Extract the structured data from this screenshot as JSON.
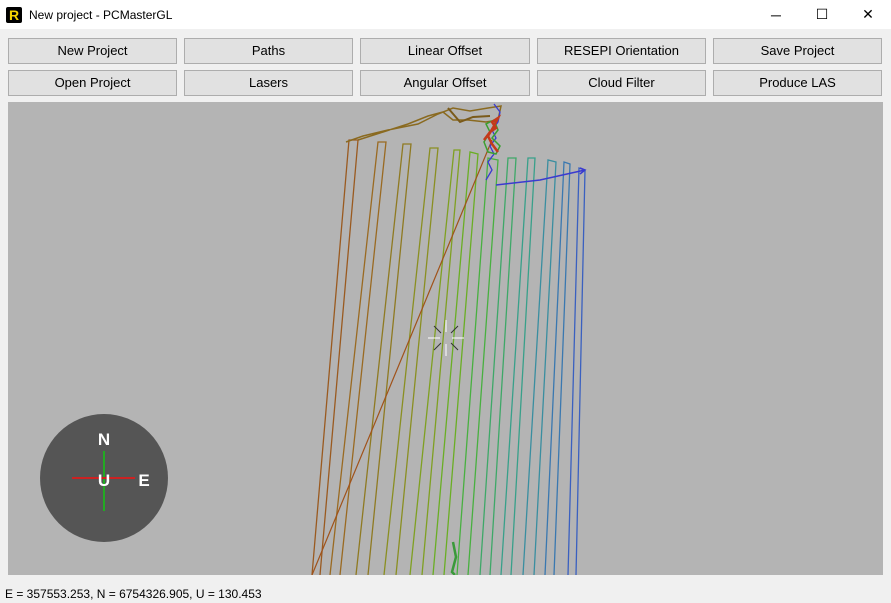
{
  "window": {
    "title": "New project - PCMasterGL",
    "app_icon_letter": "R",
    "minimize_glyph": "─",
    "maximize_glyph": "☐",
    "close_glyph": "✕"
  },
  "toolbar": {
    "row1": [
      "New Project",
      "Paths",
      "Linear Offset",
      "RESEPI Orientation",
      "Save Project"
    ],
    "row2": [
      "Open Project",
      "Lasers",
      "Angular Offset",
      "Cloud Filter",
      "Produce LAS"
    ]
  },
  "compass": {
    "north_label": "N",
    "up_label": "U",
    "east_label": "E"
  },
  "status": {
    "coordinates": "E = 357553.253, N = 6754326.905, U = 130.453"
  },
  "colors": {
    "viewport_bg": "#b4b4b4",
    "compass_bg": "#555555",
    "flight_lines": [
      "#9a5a20",
      "#9a6a22",
      "#8f7a22",
      "#8a8f22",
      "#7fa022",
      "#6aae24",
      "#58b428",
      "#48b040",
      "#3ea868",
      "#38a08a",
      "#3a8ea0",
      "#3a78b0",
      "#3a60c0",
      "#3444c8"
    ]
  },
  "icons": {
    "app": "app-logo-icon",
    "cursor": "crosshair-cursor-icon",
    "compass": "compass-icon"
  }
}
